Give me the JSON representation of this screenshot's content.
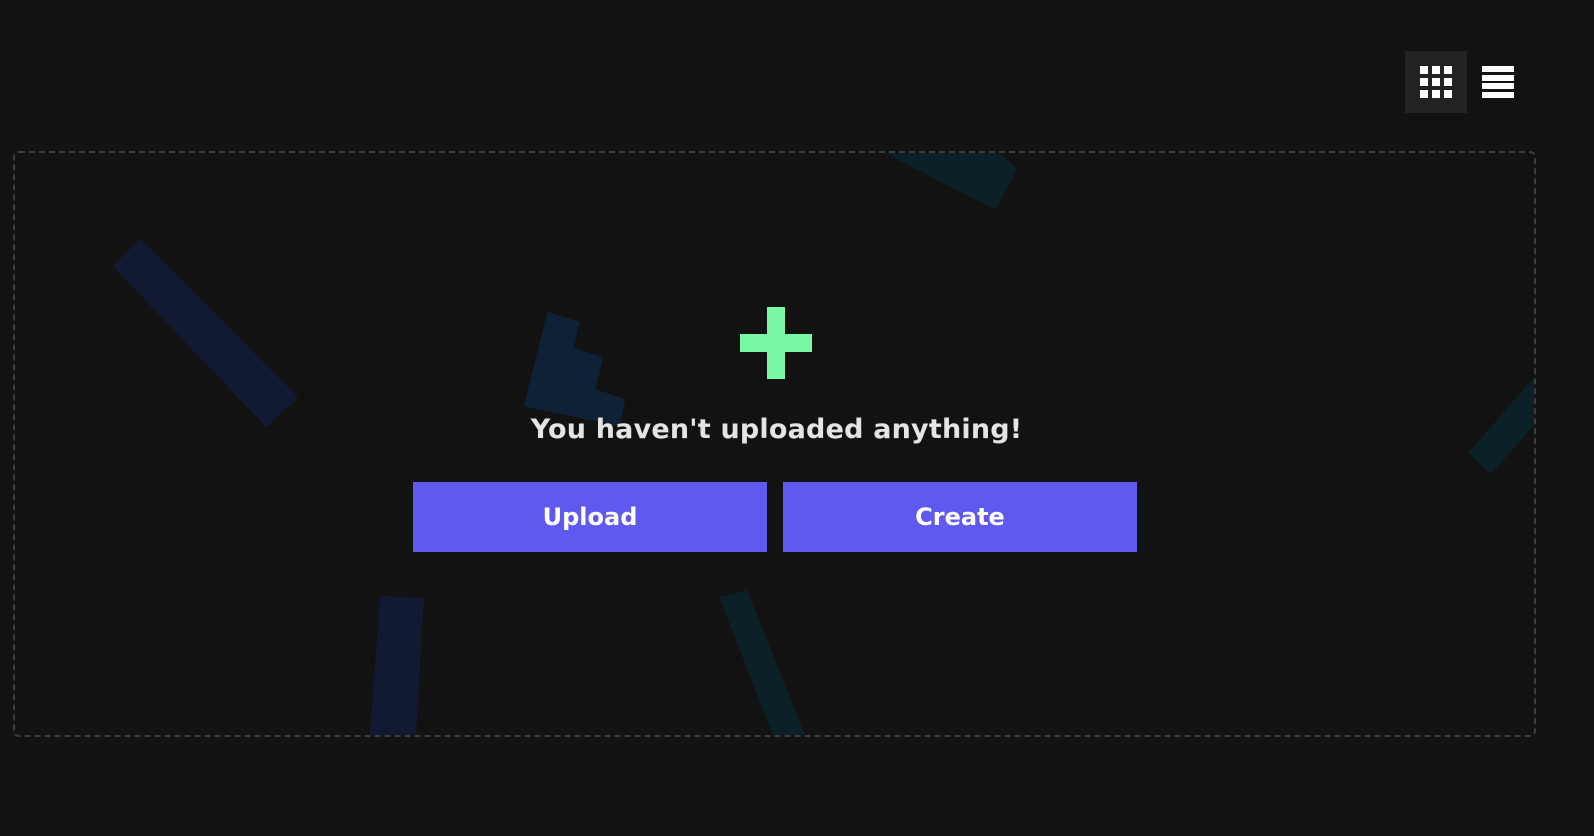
{
  "view_toggle": {
    "grid_icon": "grid-icon",
    "list_icon": "list-icon",
    "active": "grid"
  },
  "empty_state": {
    "icon": "plus-icon",
    "title": "You haven't uploaded anything!",
    "upload_label": "Upload",
    "create_label": "Create"
  },
  "colors": {
    "background": "#121212",
    "accent_button": "#6059f0",
    "plus_icon": "#79f9a6",
    "dropzone_border": "#3e3e3e"
  }
}
